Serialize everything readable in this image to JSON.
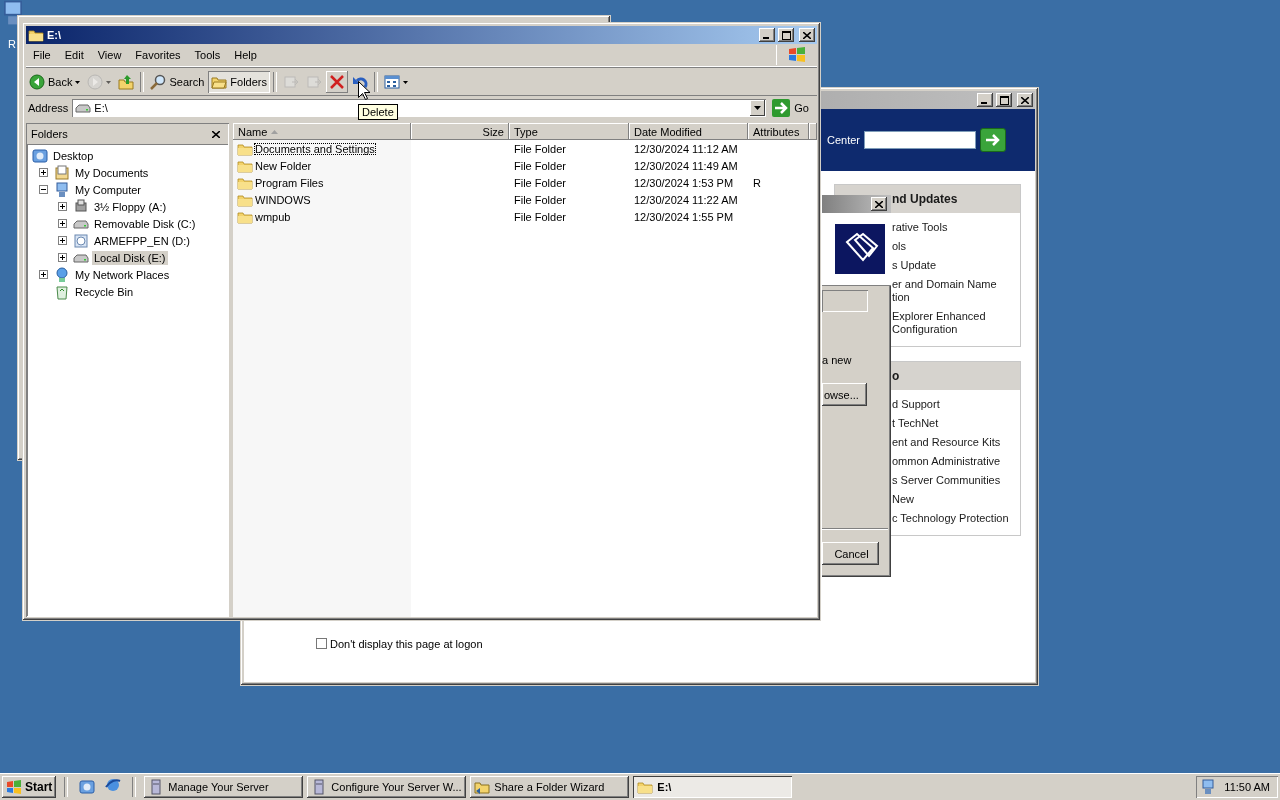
{
  "desktop": {
    "icon_label": "R"
  },
  "manage_window": {
    "search_label": "Center",
    "panels": [
      {
        "title": "nd Updates",
        "items": [
          {
            "lines": [
              "rative Tools"
            ]
          },
          {
            "lines": [
              "ols"
            ]
          },
          {
            "lines": [
              "s Update"
            ]
          },
          {
            "lines": [
              "er and Domain Name",
              "tion"
            ]
          },
          {
            "lines": [
              "Explorer Enhanced",
              "Configuration"
            ]
          }
        ]
      },
      {
        "title": "o",
        "items": [
          {
            "lines": [
              "d Support"
            ]
          },
          {
            "lines": [
              "t TechNet"
            ]
          },
          {
            "lines": [
              "ent and Resource Kits"
            ]
          },
          {
            "lines": [
              "ommon Administrative"
            ]
          },
          {
            "lines": [
              "s Server Communities"
            ]
          },
          {
            "lines": [
              "New"
            ]
          },
          {
            "lines": [
              "c Technology Protection"
            ]
          }
        ]
      }
    ],
    "logon_checkbox": {
      "label": "Don't display this page at logon",
      "checked": false
    }
  },
  "wizard": {
    "text": "a new",
    "browse": "owse...",
    "cancel": "Cancel"
  },
  "explorer": {
    "title": "E:\\",
    "menu": [
      "File",
      "Edit",
      "View",
      "Favorites",
      "Tools",
      "Help"
    ],
    "toolbar": [
      {
        "kind": "back",
        "label": "Back",
        "disabled": false,
        "pressed": false,
        "hot": false
      },
      {
        "kind": "forward",
        "disabled": true,
        "pressed": false,
        "hot": false
      },
      {
        "kind": "up",
        "disabled": false,
        "pressed": false,
        "hot": false
      },
      {
        "kind": "search",
        "label": "Search",
        "disabled": false,
        "pressed": false,
        "hot": false
      },
      {
        "kind": "folders",
        "label": "Folders",
        "disabled": false,
        "pressed": true,
        "hot": false
      },
      {
        "kind": "move",
        "disabled": true,
        "pressed": false,
        "hot": false
      },
      {
        "kind": "copy",
        "disabled": true,
        "pressed": false,
        "hot": false
      },
      {
        "kind": "delete",
        "disabled": false,
        "pressed": false,
        "hot": true
      },
      {
        "kind": "undo",
        "disabled": false,
        "pressed": false,
        "hot": false
      },
      {
        "kind": "views",
        "disabled": false,
        "pressed": false,
        "hot": false
      }
    ],
    "address": {
      "label": "Address",
      "value": "E:\\",
      "go": "Go"
    },
    "folders_pane": {
      "title": "Folders",
      "tree": [
        {
          "label": "Desktop",
          "kind": "desktop",
          "selected": false,
          "children": [
            {
              "label": "My Documents",
              "kind": "documents",
              "expanded": false,
              "selected": false
            },
            {
              "label": "My Computer",
              "kind": "computer",
              "expanded": true,
              "selected": false,
              "children": [
                {
                  "label": "3½ Floppy (A:)",
                  "kind": "floppy",
                  "expanded": false,
                  "selected": false
                },
                {
                  "label": "Removable Disk (C:)",
                  "kind": "drive",
                  "expanded": false,
                  "selected": false
                },
                {
                  "label": "ARMEFPP_EN (D:)",
                  "kind": "cdrom",
                  "expanded": false,
                  "selected": false
                },
                {
                  "label": "Local Disk (E:)",
                  "kind": "drive",
                  "expanded": false,
                  "selected": true
                }
              ]
            },
            {
              "label": "My Network Places",
              "kind": "network",
              "expanded": false,
              "selected": false
            },
            {
              "label": "Recycle Bin",
              "kind": "recycle",
              "selected": false
            }
          ]
        }
      ]
    },
    "columns": [
      {
        "label": "Name",
        "sorted": true
      },
      {
        "label": "Size",
        "sorted": false
      },
      {
        "label": "Type",
        "sorted": false
      },
      {
        "label": "Date Modified",
        "sorted": false
      },
      {
        "label": "Attributes",
        "sorted": false
      }
    ],
    "rows": [
      {
        "name": "Documents and Settings",
        "type": "File Folder",
        "modified": "12/30/2024 11:12 AM",
        "focused": true
      },
      {
        "name": "New Folder",
        "type": "File Folder",
        "modified": "12/30/2024 11:49 AM",
        "focused": false
      },
      {
        "name": "Program Files",
        "type": "File Folder",
        "modified": "12/30/2024 1:53 PM",
        "attributes": "R",
        "focused": false
      },
      {
        "name": "WINDOWS",
        "type": "File Folder",
        "modified": "12/30/2024 11:22 AM",
        "focused": false
      },
      {
        "name": "wmpub",
        "type": "File Folder",
        "modified": "12/30/2024 1:55 PM",
        "focused": false
      }
    ]
  },
  "tooltip": "Delete",
  "taskbar": {
    "start": "Start",
    "tasks": [
      {
        "label": "Manage Your Server",
        "kind": "server",
        "selected": false
      },
      {
        "label": "Configure Your Server W...",
        "kind": "server",
        "selected": false
      },
      {
        "label": "Share a Folder Wizard",
        "kind": "share",
        "selected": false
      },
      {
        "label": "E:\\",
        "kind": "folder",
        "selected": true
      }
    ],
    "clock": "11:50 AM"
  }
}
